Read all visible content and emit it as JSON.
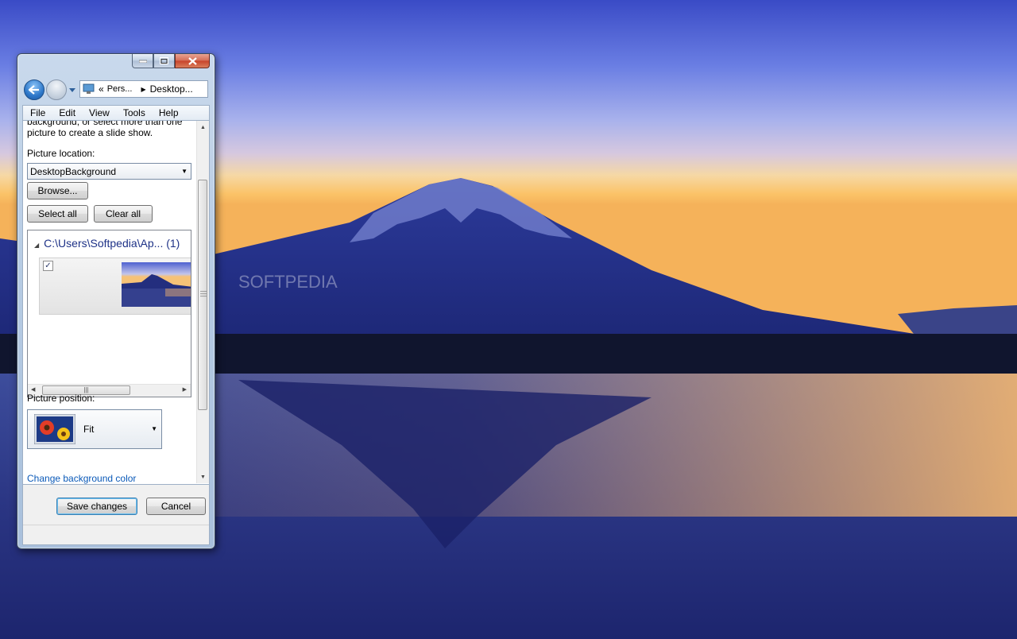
{
  "desktop": {
    "watermark": "SOFTPEDIA"
  },
  "window": {
    "nav": {
      "path": [
        "Pers...",
        "Desktop..."
      ]
    },
    "menu": [
      "File",
      "Edit",
      "View",
      "Tools",
      "Help"
    ],
    "intro_lines": [
      "background, or select more than one",
      "picture to create a slide show."
    ],
    "picture_location": {
      "label": "Picture location:",
      "value": "DesktopBackground"
    },
    "buttons": {
      "browse": "Browse...",
      "select_all": "Select all",
      "clear_all": "Clear all"
    },
    "picture_group": {
      "title": "C:\\Users\\Softpedia\\Ap...  (1)",
      "checked": true
    },
    "picture_position": {
      "label": "Picture position:",
      "value": "Fit"
    },
    "change_color_link": "Change background color",
    "footer": {
      "save": "Save changes",
      "cancel": "Cancel"
    }
  },
  "colors": {
    "link": "#0a59b8",
    "group_title": "#1e3287"
  }
}
